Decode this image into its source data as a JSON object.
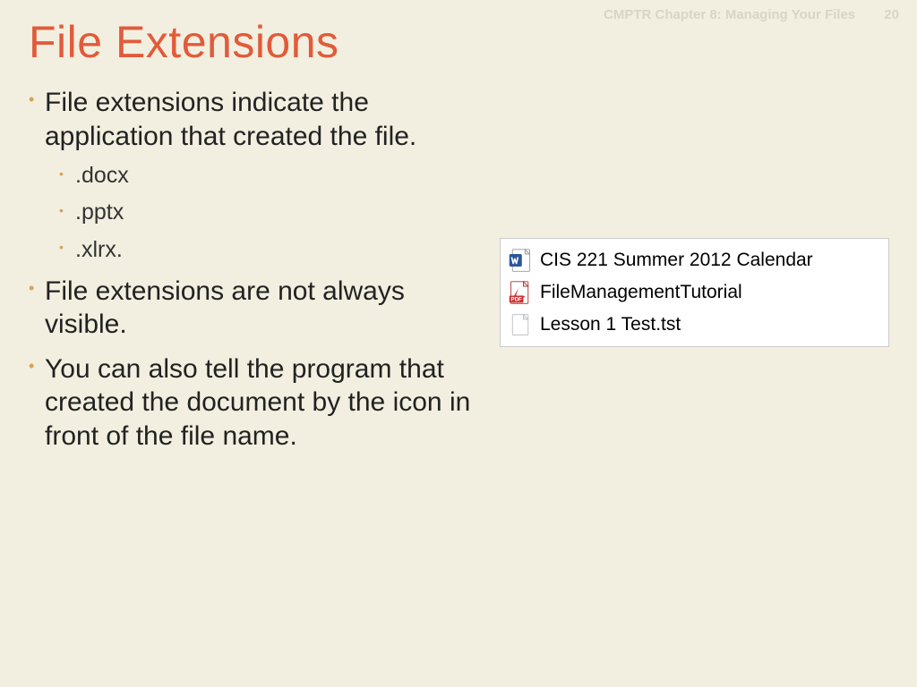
{
  "header": {
    "chapter": "CMPTR Chapter 8: Managing Your Files",
    "page": "20"
  },
  "title": "File Extensions",
  "bullets": {
    "b1": "File extensions indicate the application that created the file.",
    "sub1": ".docx",
    "sub2": ".pptx",
    "sub3": ".xlrx.",
    "b2": "File extensions are not always visible.",
    "b3": "You can also tell the program that created the document by the icon in front of the file name."
  },
  "files": {
    "f1": "CIS 221 Summer 2012 Calendar",
    "f2": "FileManagementTutorial",
    "f3": "Lesson 1 Test.tst"
  }
}
